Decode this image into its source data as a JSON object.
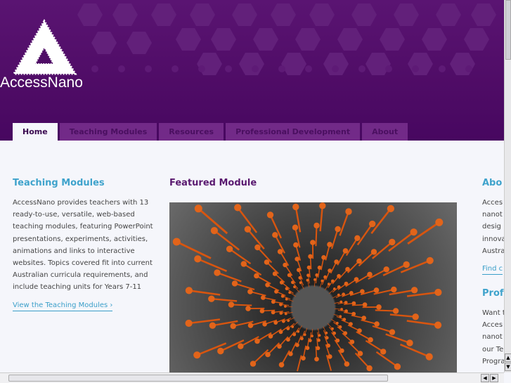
{
  "header": {
    "logo_text": "AccessNano"
  },
  "nav": {
    "tabs": [
      {
        "label": "Home",
        "active": true
      },
      {
        "label": "Teaching Modules"
      },
      {
        "label": "Resources"
      },
      {
        "label": "Professional Development"
      },
      {
        "label": "About"
      }
    ]
  },
  "teaching": {
    "heading": "Teaching Modules",
    "lines": [
      "AccessNano provides teachers with 13",
      "ready-to-use, versatile, web-based",
      "teaching modules, featuring PowerPoint",
      "presentations, experiments, activities,",
      "animations and links to interactive",
      "websites. Topics covered fit into current",
      "Australian curricula requirements, and",
      "include teaching units for Years 7-11"
    ],
    "link": "View the Teaching Modules ›"
  },
  "featured": {
    "heading": "Featured Module"
  },
  "about": {
    "heading": "Abo",
    "lines": [
      "Acces",
      "nanot",
      "desig",
      "innova",
      "Austra"
    ],
    "link": "Find c"
  },
  "prof": {
    "heading": "Profe",
    "lines": [
      "Want t",
      "Acces",
      "nanot",
      "our Te",
      "Progra"
    ]
  }
}
